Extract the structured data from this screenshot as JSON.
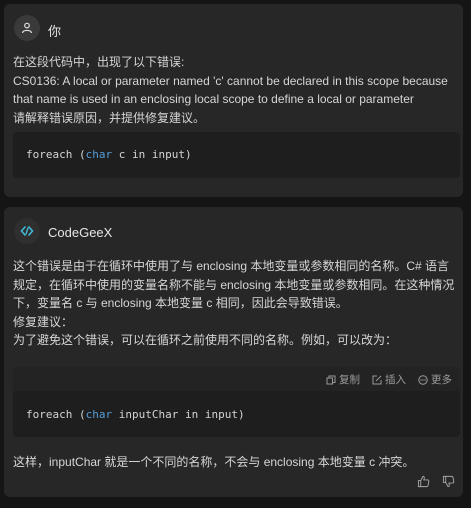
{
  "user_message": {
    "author": "你",
    "lines": [
      "在这段代码中，出现了以下错误:",
      "CS0136: A local or parameter named 'c' cannot be declared in this scope because",
      "that name is used in an enclosing local scope to define a local or parameter",
      "请解释错误原因，并提供修复建议。"
    ],
    "code": {
      "keyword": "foreach",
      "open": " (",
      "type_kw": "char",
      "rest": " c in input)"
    }
  },
  "assistant_message": {
    "author": "CodeGeeX",
    "lines": [
      "这个错误是由于在循环中使用了与 enclosing 本地变量或参数相同的名称。C# 语言",
      "规定，在循环中使用的变量名称不能与 enclosing 本地变量或参数相同。在这种情况",
      "下，变量名 c 与 enclosing 本地变量 c 相同，因此会导致错误。",
      "修复建议：",
      "为了避免这个错误，可以在循环之前使用不同的名称。例如，可以改为："
    ],
    "code_actions": {
      "copy": "复制",
      "insert": "插入",
      "more": "更多"
    },
    "code": {
      "keyword": "foreach",
      "open": " (",
      "type_kw": "char",
      "rest": " inputChar in input)"
    },
    "footer": "这样，inputChar 就是一个不同的名称，不会与 enclosing 本地变量 c 冲突。"
  },
  "colors": {
    "background": "#151515",
    "card": "#272727",
    "code_bg": "#1e1e1e",
    "keyword": "#569cd6",
    "brand": "#3fb8d6"
  }
}
